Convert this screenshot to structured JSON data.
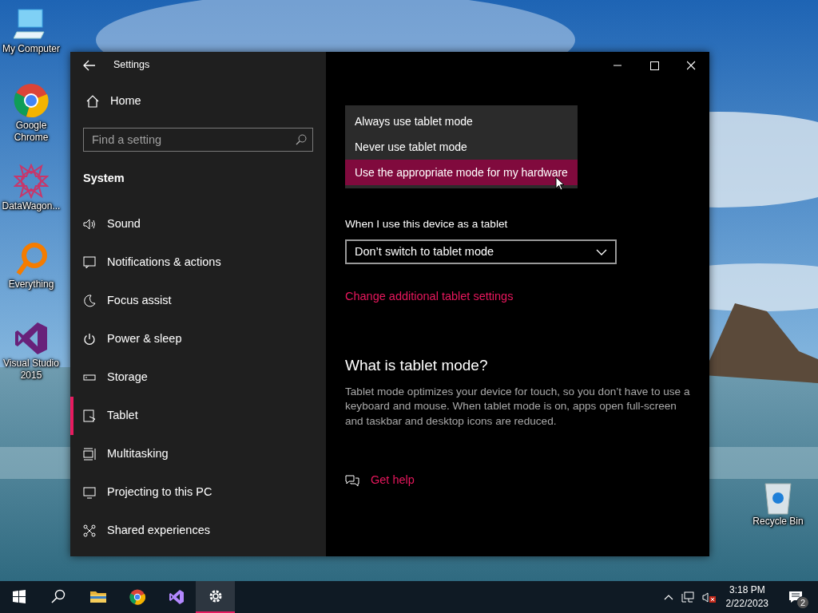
{
  "desktop_icons": [
    {
      "kind": "computer",
      "label": "My Computer"
    },
    {
      "kind": "chrome",
      "label": "Google Chrome"
    },
    {
      "kind": "star",
      "label": "DataWagon..."
    },
    {
      "kind": "magnifier",
      "label": "Everything"
    },
    {
      "kind": "vs",
      "label": "Visual Studio 2015"
    },
    {
      "kind": "bin",
      "label": "Recycle Bin"
    }
  ],
  "window": {
    "title": "Settings",
    "sidebar": {
      "home": "Home",
      "search": {
        "placeholder": "Find a setting"
      },
      "section": "System",
      "items": [
        {
          "kind": "sound",
          "label": "Sound",
          "selected": false
        },
        {
          "kind": "notifications",
          "label": "Notifications & actions",
          "selected": false
        },
        {
          "kind": "focus",
          "label": "Focus assist",
          "selected": false
        },
        {
          "kind": "power",
          "label": "Power & sleep",
          "selected": false
        },
        {
          "kind": "storage",
          "label": "Storage",
          "selected": false
        },
        {
          "kind": "tablet",
          "label": "Tablet",
          "selected": true
        },
        {
          "kind": "multitasking",
          "label": "Multitasking",
          "selected": false
        },
        {
          "kind": "projecting",
          "label": "Projecting to this PC",
          "selected": false
        },
        {
          "kind": "shared",
          "label": "Shared experiences",
          "selected": false
        }
      ]
    },
    "content": {
      "dropdown_menu": [
        {
          "label": "Always use tablet mode",
          "selected": false
        },
        {
          "label": "Never use tablet mode",
          "selected": false
        },
        {
          "label": "Use the appropriate mode for my hardware",
          "selected": true
        }
      ],
      "field_label": "When I use this device as a tablet",
      "select": {
        "value": "Don’t switch to tablet mode"
      },
      "link": "Change additional tablet settings",
      "heading": "What is tablet mode?",
      "description": "Tablet mode optimizes your device for touch, so you don’t have to use a keyboard and mouse. When tablet mode is on, apps open full-screen and taskbar and desktop icons are reduced.",
      "help_link": "Get help"
    }
  },
  "taskbar": {
    "items": [
      {
        "kind": "start",
        "selected": false
      },
      {
        "kind": "search",
        "selected": false
      },
      {
        "kind": "explorer",
        "selected": false
      },
      {
        "kind": "chrome",
        "selected": false
      },
      {
        "kind": "vs",
        "selected": false
      },
      {
        "kind": "settings",
        "selected": true
      }
    ],
    "time": "3:18 PM",
    "date": "2/22/2023",
    "notification_count": "2"
  }
}
